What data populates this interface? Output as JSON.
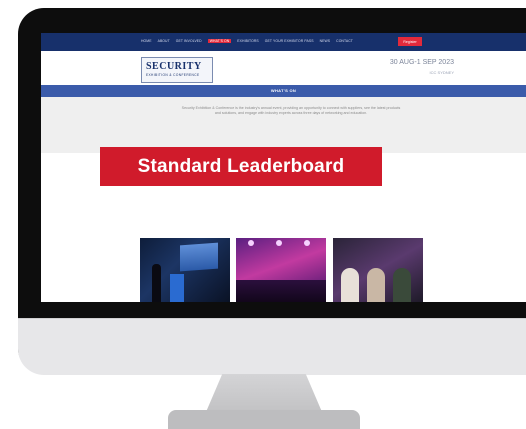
{
  "nav": {
    "items": [
      "HOME",
      "ABOUT",
      "GET INVOLVED",
      "WHAT'S ON",
      "EXHIBITORS",
      "GET YOUR EXHIBITOR PASS",
      "NEWS",
      "CONTACT"
    ],
    "active_index": 3,
    "register_label": "Register"
  },
  "header": {
    "logo_main": "SECURITY",
    "logo_sub": "EXHIBITION & CONFERENCE",
    "date": "30 AUG-1 SEP 2023",
    "venue": "ICC SYDNEY"
  },
  "section": {
    "title": "WHAT'S ON",
    "intro": "Security Exhibition & Conference is the industry's annual event, providing an opportunity to connect with suppliers, see the latest products and solutions, and engage with industry experts across three days of networking and education."
  },
  "banner": {
    "label": "Standard Leaderboard"
  },
  "colors": {
    "nav_bg": "#17306b",
    "accent_red": "#d01b2b",
    "section_bar": "#3b5baa"
  }
}
